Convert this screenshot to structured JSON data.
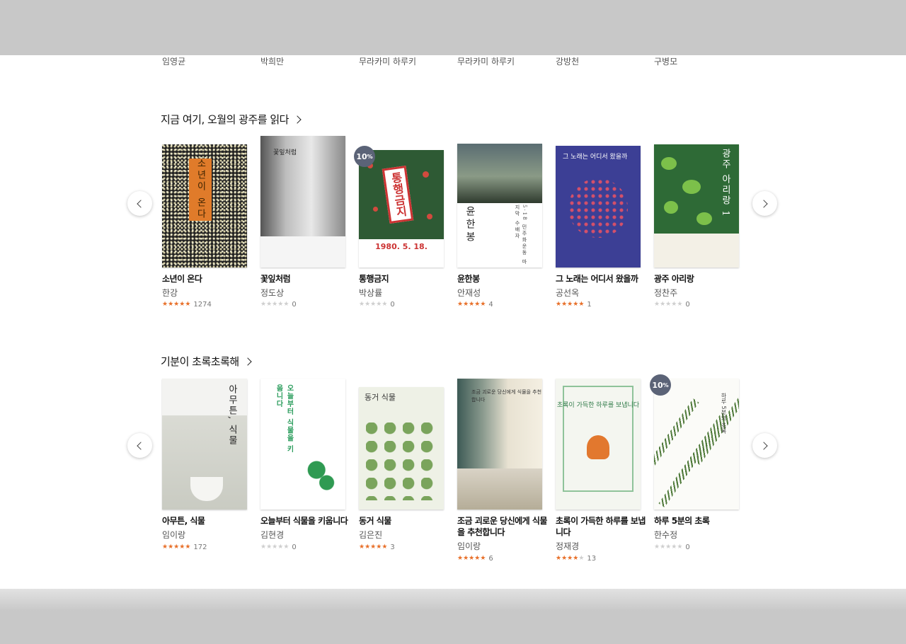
{
  "top_authors": [
    "임영균",
    "박희만",
    "무라카미 하루키",
    "무라카미 하루키",
    "강방천",
    "구병모"
  ],
  "sections": [
    {
      "title": "지금 여기, 오월의 광주를 읽다",
      "books": [
        {
          "title": "소년이 온다",
          "author": "한강",
          "rating": 5,
          "count": "1274",
          "discount": "",
          "cover_text": "소년이 온다"
        },
        {
          "title": "꽃잎처럼",
          "author": "정도상",
          "rating": 0,
          "count": "0",
          "discount": "",
          "cover_text": "꽃잎처럼"
        },
        {
          "title": "통행금지",
          "author": "박상률",
          "rating": 0,
          "count": "0",
          "discount": "10",
          "cover_text": "통행금지",
          "cover_sub": "1980. 5. 18."
        },
        {
          "title": "윤한봉",
          "author": "안재성",
          "rating": 5,
          "count": "4",
          "discount": "",
          "cover_text": "윤한봉",
          "cover_sub": "5·18 민주화운동 마지막 수배자"
        },
        {
          "title": "그 노래는 어디서 왔을까",
          "author": "공선옥",
          "rating": 5,
          "count": "1",
          "discount": "",
          "cover_text": "그 노래는 어디서 왔을까"
        },
        {
          "title": "광주 아리랑",
          "author": "정찬주",
          "rating": 0,
          "count": "0",
          "discount": "",
          "cover_text": "광주 아리랑 1"
        }
      ]
    },
    {
      "title": "기분이 초록초록해",
      "books": [
        {
          "title": "아무튼, 식물",
          "author": "임이랑",
          "rating": 4.5,
          "count": "172",
          "discount": "",
          "cover_text": "아무튼, 식물"
        },
        {
          "title": "오늘부터 식물을 키웁니다",
          "author": "김현경",
          "rating": 0,
          "count": "0",
          "discount": "",
          "cover_text": "오늘부터 식물을 키웁니다"
        },
        {
          "title": "동거 식물",
          "author": "김은진",
          "rating": 5,
          "count": "3",
          "discount": "",
          "cover_text": "동거 식물"
        },
        {
          "title": "조금 괴로운 당신에게 식물을 추천합니다",
          "author": "임이랑",
          "rating": 5,
          "count": "6",
          "discount": "",
          "cover_text": "조금 괴로운 당신에게 식물을 추천합니다"
        },
        {
          "title": "초록이 가득한 하루를 보냅니다",
          "author": "정재경",
          "rating": 4,
          "count": "13",
          "discount": "",
          "cover_text": "초록이 가득한 하루를 보냅니다"
        },
        {
          "title": "하루 5분의 초록",
          "author": "한수정",
          "rating": 0,
          "count": "0",
          "discount": "10",
          "cover_text": "하루 5분의 초록"
        }
      ]
    }
  ],
  "icons": {
    "prev": "chevron-left-icon",
    "next": "chevron-right-icon",
    "star": "star-icon"
  },
  "colors": {
    "star_on": "#e8702a",
    "star_off": "#cfcfcf",
    "discount_badge": "#5b6377"
  }
}
